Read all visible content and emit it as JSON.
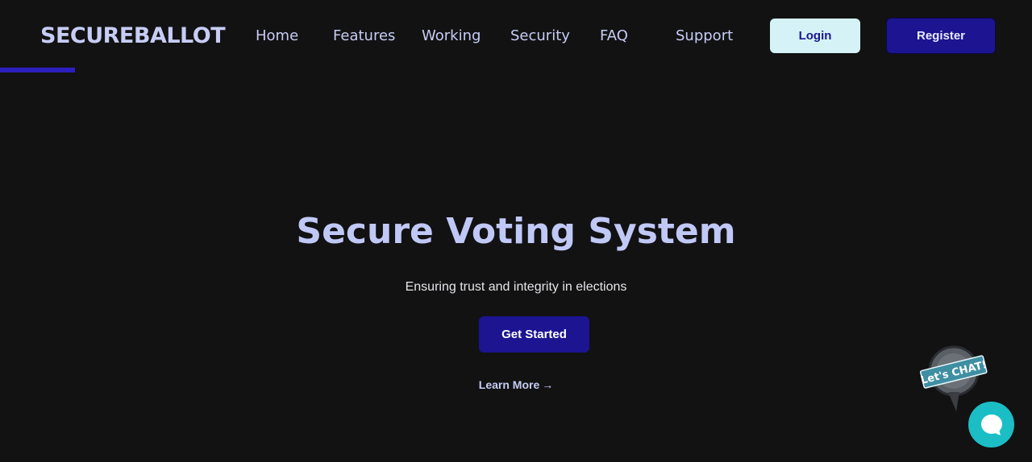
{
  "header": {
    "brand": "SECUREBALLOT",
    "nav": [
      {
        "label": "Home"
      },
      {
        "label": "Features"
      },
      {
        "label": "Working"
      },
      {
        "label": "Security"
      },
      {
        "label": "FAQ"
      },
      {
        "label": "Support"
      }
    ],
    "login_label": "Login",
    "register_label": "Register",
    "scroll_progress_percent": 7.3
  },
  "hero": {
    "title": "Secure Voting System",
    "subtitle": "Ensuring trust and integrity in elections",
    "cta_label": "Get Started",
    "learn_more_label": "Learn More",
    "learn_more_arrow": "→"
  },
  "chat": {
    "badge_text": "Let's CHAT!",
    "badge_icon": "speech-bubble-icon",
    "button_icon": "chat-bubble-icon"
  },
  "colors": {
    "background": "#121213",
    "brand_text": "#c7cdf4",
    "primary": "#1c1491",
    "login_bg": "#d5f3f6",
    "progress": "#2c1fbf",
    "chat_accent": "#1bbec5"
  }
}
